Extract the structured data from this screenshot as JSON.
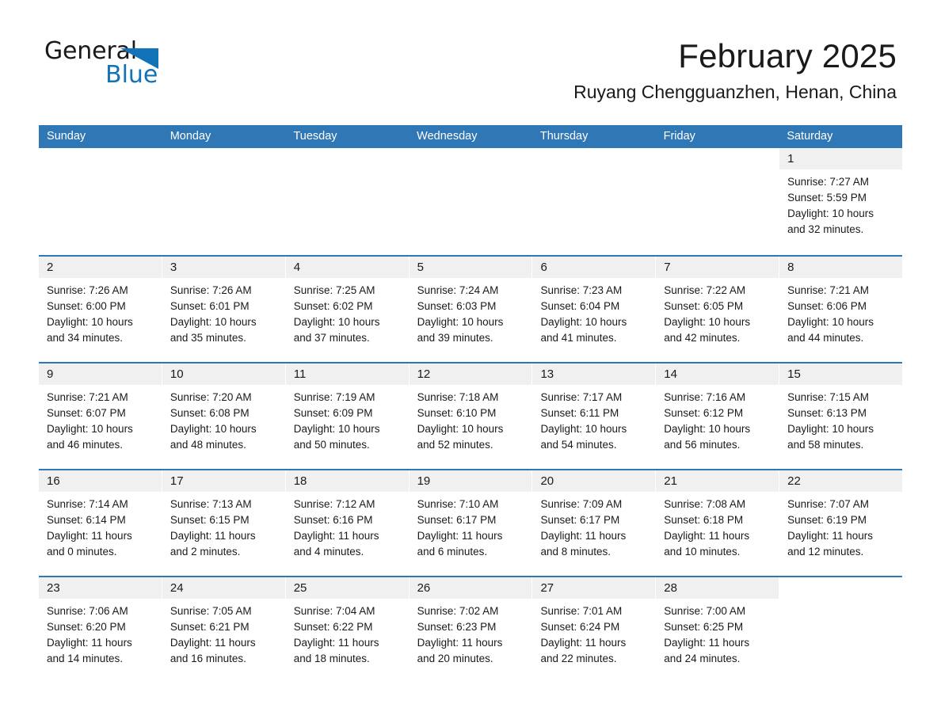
{
  "brand": {
    "name_part1": "General",
    "name_part2": "Blue",
    "accent_color": "#1273b8"
  },
  "header": {
    "month_title": "February 2025",
    "location": "Ruyang Chengguanzhen, Henan, China",
    "header_bar_color": "#2f78b5"
  },
  "weekdays": [
    {
      "label": "Sunday"
    },
    {
      "label": "Monday"
    },
    {
      "label": "Tuesday"
    },
    {
      "label": "Wednesday"
    },
    {
      "label": "Thursday"
    },
    {
      "label": "Friday"
    },
    {
      "label": "Saturday"
    }
  ],
  "weeks": [
    {
      "days": [
        {
          "number": "",
          "sunrise": "",
          "sunset": "",
          "daylight_line1": "",
          "daylight_line2": "",
          "filled": false
        },
        {
          "number": "",
          "sunrise": "",
          "sunset": "",
          "daylight_line1": "",
          "daylight_line2": "",
          "filled": false
        },
        {
          "number": "",
          "sunrise": "",
          "sunset": "",
          "daylight_line1": "",
          "daylight_line2": "",
          "filled": false
        },
        {
          "number": "",
          "sunrise": "",
          "sunset": "",
          "daylight_line1": "",
          "daylight_line2": "",
          "filled": false
        },
        {
          "number": "",
          "sunrise": "",
          "sunset": "",
          "daylight_line1": "",
          "daylight_line2": "",
          "filled": false
        },
        {
          "number": "",
          "sunrise": "",
          "sunset": "",
          "daylight_line1": "",
          "daylight_line2": "",
          "filled": false
        },
        {
          "number": "1",
          "sunrise": "Sunrise: 7:27 AM",
          "sunset": "Sunset: 5:59 PM",
          "daylight_line1": "Daylight: 10 hours",
          "daylight_line2": "and 32 minutes.",
          "filled": true
        }
      ]
    },
    {
      "days": [
        {
          "number": "2",
          "sunrise": "Sunrise: 7:26 AM",
          "sunset": "Sunset: 6:00 PM",
          "daylight_line1": "Daylight: 10 hours",
          "daylight_line2": "and 34 minutes.",
          "filled": true
        },
        {
          "number": "3",
          "sunrise": "Sunrise: 7:26 AM",
          "sunset": "Sunset: 6:01 PM",
          "daylight_line1": "Daylight: 10 hours",
          "daylight_line2": "and 35 minutes.",
          "filled": true
        },
        {
          "number": "4",
          "sunrise": "Sunrise: 7:25 AM",
          "sunset": "Sunset: 6:02 PM",
          "daylight_line1": "Daylight: 10 hours",
          "daylight_line2": "and 37 minutes.",
          "filled": true
        },
        {
          "number": "5",
          "sunrise": "Sunrise: 7:24 AM",
          "sunset": "Sunset: 6:03 PM",
          "daylight_line1": "Daylight: 10 hours",
          "daylight_line2": "and 39 minutes.",
          "filled": true
        },
        {
          "number": "6",
          "sunrise": "Sunrise: 7:23 AM",
          "sunset": "Sunset: 6:04 PM",
          "daylight_line1": "Daylight: 10 hours",
          "daylight_line2": "and 41 minutes.",
          "filled": true
        },
        {
          "number": "7",
          "sunrise": "Sunrise: 7:22 AM",
          "sunset": "Sunset: 6:05 PM",
          "daylight_line1": "Daylight: 10 hours",
          "daylight_line2": "and 42 minutes.",
          "filled": true
        },
        {
          "number": "8",
          "sunrise": "Sunrise: 7:21 AM",
          "sunset": "Sunset: 6:06 PM",
          "daylight_line1": "Daylight: 10 hours",
          "daylight_line2": "and 44 minutes.",
          "filled": true
        }
      ]
    },
    {
      "days": [
        {
          "number": "9",
          "sunrise": "Sunrise: 7:21 AM",
          "sunset": "Sunset: 6:07 PM",
          "daylight_line1": "Daylight: 10 hours",
          "daylight_line2": "and 46 minutes.",
          "filled": true
        },
        {
          "number": "10",
          "sunrise": "Sunrise: 7:20 AM",
          "sunset": "Sunset: 6:08 PM",
          "daylight_line1": "Daylight: 10 hours",
          "daylight_line2": "and 48 minutes.",
          "filled": true
        },
        {
          "number": "11",
          "sunrise": "Sunrise: 7:19 AM",
          "sunset": "Sunset: 6:09 PM",
          "daylight_line1": "Daylight: 10 hours",
          "daylight_line2": "and 50 minutes.",
          "filled": true
        },
        {
          "number": "12",
          "sunrise": "Sunrise: 7:18 AM",
          "sunset": "Sunset: 6:10 PM",
          "daylight_line1": "Daylight: 10 hours",
          "daylight_line2": "and 52 minutes.",
          "filled": true
        },
        {
          "number": "13",
          "sunrise": "Sunrise: 7:17 AM",
          "sunset": "Sunset: 6:11 PM",
          "daylight_line1": "Daylight: 10 hours",
          "daylight_line2": "and 54 minutes.",
          "filled": true
        },
        {
          "number": "14",
          "sunrise": "Sunrise: 7:16 AM",
          "sunset": "Sunset: 6:12 PM",
          "daylight_line1": "Daylight: 10 hours",
          "daylight_line2": "and 56 minutes.",
          "filled": true
        },
        {
          "number": "15",
          "sunrise": "Sunrise: 7:15 AM",
          "sunset": "Sunset: 6:13 PM",
          "daylight_line1": "Daylight: 10 hours",
          "daylight_line2": "and 58 minutes.",
          "filled": true
        }
      ]
    },
    {
      "days": [
        {
          "number": "16",
          "sunrise": "Sunrise: 7:14 AM",
          "sunset": "Sunset: 6:14 PM",
          "daylight_line1": "Daylight: 11 hours",
          "daylight_line2": "and 0 minutes.",
          "filled": true
        },
        {
          "number": "17",
          "sunrise": "Sunrise: 7:13 AM",
          "sunset": "Sunset: 6:15 PM",
          "daylight_line1": "Daylight: 11 hours",
          "daylight_line2": "and 2 minutes.",
          "filled": true
        },
        {
          "number": "18",
          "sunrise": "Sunrise: 7:12 AM",
          "sunset": "Sunset: 6:16 PM",
          "daylight_line1": "Daylight: 11 hours",
          "daylight_line2": "and 4 minutes.",
          "filled": true
        },
        {
          "number": "19",
          "sunrise": "Sunrise: 7:10 AM",
          "sunset": "Sunset: 6:17 PM",
          "daylight_line1": "Daylight: 11 hours",
          "daylight_line2": "and 6 minutes.",
          "filled": true
        },
        {
          "number": "20",
          "sunrise": "Sunrise: 7:09 AM",
          "sunset": "Sunset: 6:17 PM",
          "daylight_line1": "Daylight: 11 hours",
          "daylight_line2": "and 8 minutes.",
          "filled": true
        },
        {
          "number": "21",
          "sunrise": "Sunrise: 7:08 AM",
          "sunset": "Sunset: 6:18 PM",
          "daylight_line1": "Daylight: 11 hours",
          "daylight_line2": "and 10 minutes.",
          "filled": true
        },
        {
          "number": "22",
          "sunrise": "Sunrise: 7:07 AM",
          "sunset": "Sunset: 6:19 PM",
          "daylight_line1": "Daylight: 11 hours",
          "daylight_line2": "and 12 minutes.",
          "filled": true
        }
      ]
    },
    {
      "days": [
        {
          "number": "23",
          "sunrise": "Sunrise: 7:06 AM",
          "sunset": "Sunset: 6:20 PM",
          "daylight_line1": "Daylight: 11 hours",
          "daylight_line2": "and 14 minutes.",
          "filled": true
        },
        {
          "number": "24",
          "sunrise": "Sunrise: 7:05 AM",
          "sunset": "Sunset: 6:21 PM",
          "daylight_line1": "Daylight: 11 hours",
          "daylight_line2": "and 16 minutes.",
          "filled": true
        },
        {
          "number": "25",
          "sunrise": "Sunrise: 7:04 AM",
          "sunset": "Sunset: 6:22 PM",
          "daylight_line1": "Daylight: 11 hours",
          "daylight_line2": "and 18 minutes.",
          "filled": true
        },
        {
          "number": "26",
          "sunrise": "Sunrise: 7:02 AM",
          "sunset": "Sunset: 6:23 PM",
          "daylight_line1": "Daylight: 11 hours",
          "daylight_line2": "and 20 minutes.",
          "filled": true
        },
        {
          "number": "27",
          "sunrise": "Sunrise: 7:01 AM",
          "sunset": "Sunset: 6:24 PM",
          "daylight_line1": "Daylight: 11 hours",
          "daylight_line2": "and 22 minutes.",
          "filled": true
        },
        {
          "number": "28",
          "sunrise": "Sunrise: 7:00 AM",
          "sunset": "Sunset: 6:25 PM",
          "daylight_line1": "Daylight: 11 hours",
          "daylight_line2": "and 24 minutes.",
          "filled": true
        },
        {
          "number": "",
          "sunrise": "",
          "sunset": "",
          "daylight_line1": "",
          "daylight_line2": "",
          "filled": false
        }
      ]
    }
  ]
}
